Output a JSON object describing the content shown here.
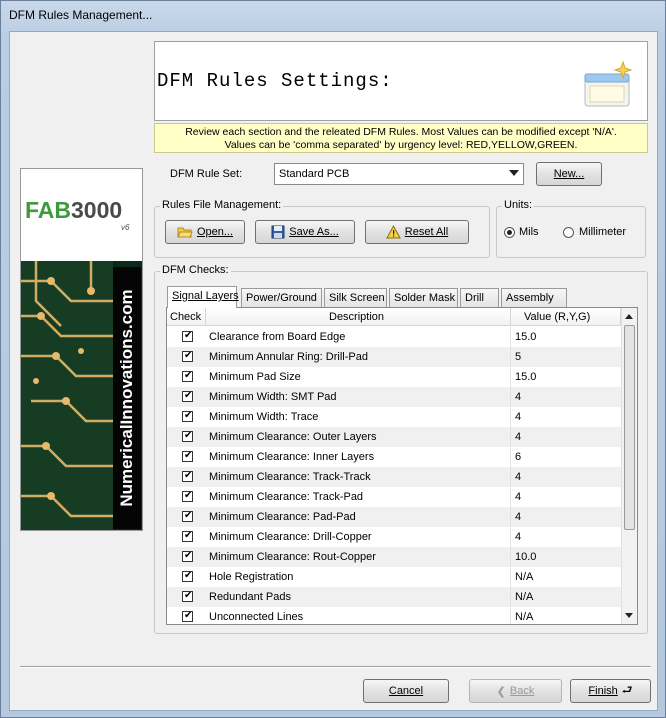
{
  "window": {
    "title": "DFM Rules Management..."
  },
  "header": {
    "title": "DFM Rules Settings:",
    "notice_line1": "Review each section and the releated DFM Rules. Most Values can be modified except 'N/A'.",
    "notice_line2": "Values can be 'comma separated' by urgency level: RED,YELLOW,GREEN."
  },
  "branding": {
    "logo_fab": "FAB",
    "logo_num": "3000",
    "logo_version": "v6",
    "vertical_text": "NumericalInnovations.com"
  },
  "ruleset": {
    "label": "DFM Rule Set:",
    "selected": "Standard PCB",
    "new_button": "New..."
  },
  "rules_file": {
    "title": "Rules File Management:",
    "open": "Open...",
    "save_as": "Save As...",
    "reset_all": "Reset All"
  },
  "units": {
    "title": "Units:",
    "options": [
      "Mils",
      "Millimeter"
    ],
    "selected": "Mils"
  },
  "checks": {
    "title": "DFM Checks:",
    "tabs": [
      "Signal Layers",
      "Power/Ground",
      "Silk Screen",
      "Solder Mask",
      "Drill",
      "Assembly"
    ],
    "active_tab": "Signal Layers",
    "columns": [
      "Check",
      "Description",
      "Value (R,Y,G)"
    ],
    "rows": [
      {
        "checked": true,
        "description": "Clearance from Board Edge",
        "value": "15.0"
      },
      {
        "checked": true,
        "description": "Minimum Annular Ring: Drill-Pad",
        "value": "5"
      },
      {
        "checked": true,
        "description": "Minimum Pad Size",
        "value": "15.0"
      },
      {
        "checked": true,
        "description": "Minimum Width: SMT Pad",
        "value": "4"
      },
      {
        "checked": true,
        "description": "Minimum Width: Trace",
        "value": "4"
      },
      {
        "checked": true,
        "description": "Minimum Clearance: Outer Layers",
        "value": "4"
      },
      {
        "checked": true,
        "description": "Minimum Clearance: Inner Layers",
        "value": "6"
      },
      {
        "checked": true,
        "description": "Minimum Clearance: Track-Track",
        "value": "4"
      },
      {
        "checked": true,
        "description": "Minimum Clearance: Track-Pad",
        "value": "4"
      },
      {
        "checked": true,
        "description": "Minimum Clearance: Pad-Pad",
        "value": "4"
      },
      {
        "checked": true,
        "description": "Minimum Clearance: Drill-Copper",
        "value": "4"
      },
      {
        "checked": true,
        "description": "Minimum Clearance: Rout-Copper",
        "value": "10.0"
      },
      {
        "checked": true,
        "description": "Hole Registration",
        "value": "N/A"
      },
      {
        "checked": true,
        "description": "Redundant Pads",
        "value": "N/A"
      },
      {
        "checked": true,
        "description": "Unconnected Lines",
        "value": "N/A"
      }
    ]
  },
  "footer": {
    "cancel": "Cancel",
    "back": "Back",
    "finish": "Finish"
  },
  "icons": {
    "open": "folder-open-icon",
    "save": "floppy-disk-icon",
    "reset": "warning-icon",
    "back": "back-arrow-icon",
    "finish": "enter-icon"
  }
}
